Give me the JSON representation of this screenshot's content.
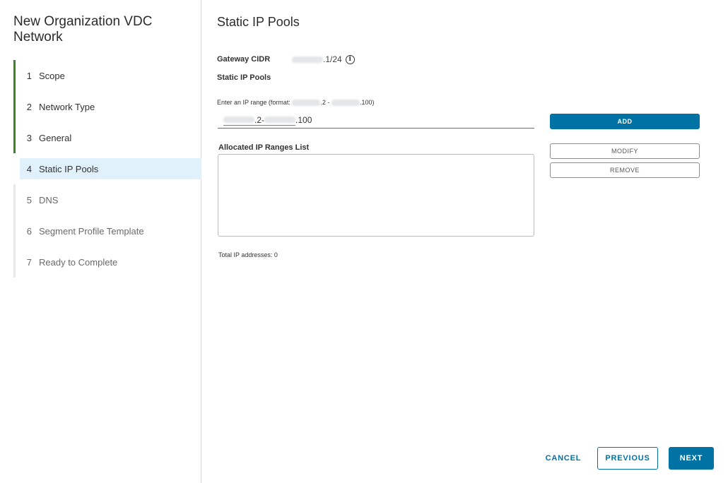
{
  "wizard": {
    "title": "New Organization VDC Network",
    "steps": [
      {
        "num": "1",
        "label": "Scope",
        "state": "done"
      },
      {
        "num": "2",
        "label": "Network Type",
        "state": "done"
      },
      {
        "num": "3",
        "label": "General",
        "state": "done"
      },
      {
        "num": "4",
        "label": "Static IP Pools",
        "state": "current"
      },
      {
        "num": "5",
        "label": "DNS",
        "state": "future"
      },
      {
        "num": "6",
        "label": "Segment Profile Template",
        "state": "future"
      },
      {
        "num": "7",
        "label": "Ready to Complete",
        "state": "future"
      }
    ]
  },
  "main": {
    "title": "Static IP Pools",
    "gateway_cidr_label": "Gateway CIDR",
    "gateway_cidr_suffix": ".1/24",
    "info_icon": "info-icon",
    "static_ip_pools_label": "Static IP Pools",
    "range_hint_prefix": "Enter an IP range (format:",
    "range_hint_mid": ".2 -",
    "range_hint_suffix": ".100)",
    "ip_input": {
      "part_a": ".2-",
      "part_b": ".100"
    },
    "allocated_list_label": "Allocated IP Ranges List",
    "total_ip_text": "Total IP addresses: 0"
  },
  "actions": {
    "add": "ADD",
    "modify": "MODIFY",
    "remove": "REMOVE"
  },
  "footer": {
    "cancel": "CANCEL",
    "previous": "PREVIOUS",
    "next": "NEXT"
  },
  "colors": {
    "primary": "#0072a3",
    "step_done": "#3e8424",
    "step_current_bg": "#e1f1fb"
  }
}
